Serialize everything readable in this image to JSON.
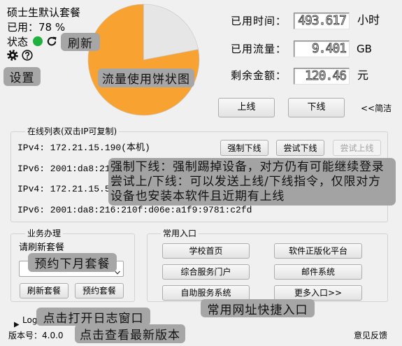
{
  "account": {
    "package_name": "硕士生默认套餐",
    "usage_text": "已用：78 %",
    "status_label": "状态",
    "status_color": "#1fb13e",
    "status_icon": "status-indicator",
    "refresh_icon": "refresh-icon",
    "settings_icon": "gear-icon",
    "help_icon": "help-icon"
  },
  "stats": [
    {
      "label": "已用时间：",
      "value": "493.617",
      "unit": "小时"
    },
    {
      "label": "已用流量：",
      "value": "9.401",
      "unit": "GB"
    },
    {
      "label": "剩余金额：",
      "value": "120.46",
      "unit": "元"
    }
  ],
  "controls": {
    "online_button": "上线",
    "offline_button": "下线",
    "compact_link": "<<简洁"
  },
  "online_list": {
    "title": "在线列表(双击IP可复制)",
    "entries": [
      "IPv4: 172.21.15.190(本机)",
      "IPv6: 2001:da8:21",
      "IPv4: 172.21.15.5",
      "IPv6: 2001:da8:216:210f:d06e:a1f9:9781:c2fd"
    ],
    "force_offline_button": "强制下线",
    "try_offline_button": "尝试下线",
    "try_online_button": "尝试上线",
    "try_online_enabled": false
  },
  "business": {
    "title": "业务办理",
    "hint": "请刷新套餐",
    "dropdown_icon": "chevron-down-icon",
    "refresh_button": "刷新套餐",
    "reserve_button": "预约套餐"
  },
  "shortcuts": {
    "title": "常用入口",
    "buttons": [
      "学校首页",
      "软件正版化平台",
      "综合服务门户",
      "邮件系统",
      "自助服务系统",
      "更多入口>>"
    ]
  },
  "footer": {
    "log_icon": "triangle-right-icon",
    "log_label": "Log",
    "version": "版本号：4.0.0",
    "feedback": "意见反馈"
  },
  "annotations": {
    "refresh": "刷新",
    "settings": "设置",
    "pie": "流量使用饼状图",
    "online_list": [
      "强制下线：强制踢掉设备，对方仍有可能继续登录",
      "尝试上/下线：可以发送上线/下线指令，仅限对方",
      "设备也安装本软件且近期有上线"
    ],
    "reserve": "预约下月套餐",
    "shortcuts": "常用网址快捷入口",
    "log": "点击打开日志窗口",
    "version": "点击查看最新版本"
  },
  "chart_data": {
    "type": "pie",
    "values": [
      78,
      22
    ],
    "colors": [
      "#f8a232",
      "#e6e6e6"
    ]
  }
}
